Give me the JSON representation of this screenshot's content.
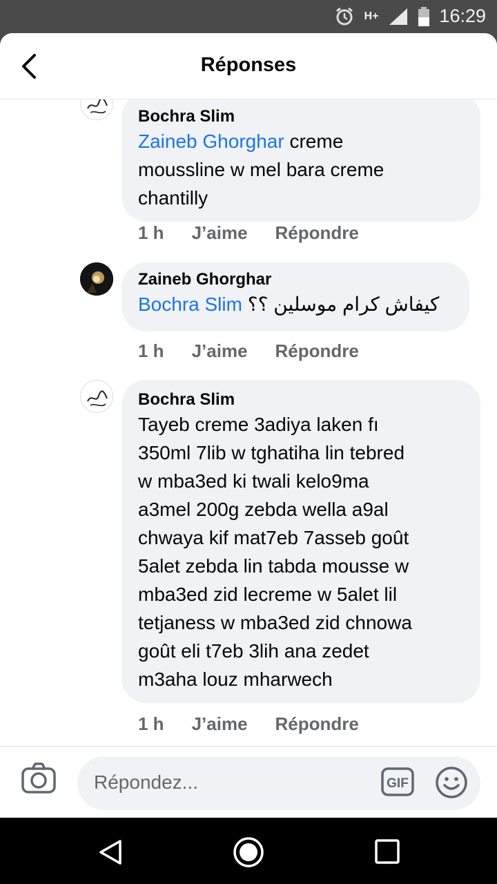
{
  "status": {
    "time": "16:29",
    "network": "H+"
  },
  "header": {
    "title": "Réponses"
  },
  "comments": [
    {
      "author": "Bochra Slim",
      "mention": "Zaineb Ghorghar",
      "lines": [
        " creme",
        "moussline w mel bara creme",
        "chantilly"
      ],
      "time": "1 h",
      "like": "J’aime",
      "reply": "Répondre"
    },
    {
      "author": "Zaineb Ghorghar",
      "mention": "Bochra Slim",
      "rest": " كيفاش كرام موسلين ؟؟",
      "time": "1 h",
      "like": "J’aime",
      "reply": "Répondre"
    },
    {
      "author": "Bochra Slim",
      "lines": [
        "Tayeb creme 3adiya laken fı",
        "350ml 7lib w tghatiha lin tebred",
        "w mba3ed ki twali kelo9ma",
        "a3mel 200g zebda wella a9al",
        "chwaya kif mat7eb 7asseb goût",
        "5alet zebda lin tabda mousse w",
        "mba3ed zid lecreme w 5alet lil",
        "tetjaness w mba3ed zid chnowa",
        "goût eli t7eb 3lih ana zedet",
        "m3aha louz mharwech"
      ],
      "time": "1 h",
      "like": "J’aime",
      "reply": "Répondre"
    }
  ],
  "composer": {
    "placeholder": "Répondez...",
    "gif_label": "GIF"
  },
  "colors": {
    "mention": "#1b74e4",
    "bubble": "#f0f2f5",
    "secondary_text": "#65676b"
  },
  "icons": [
    "back-arrow-icon",
    "alarm-icon",
    "signal-icon",
    "battery-icon",
    "camera-icon",
    "gif-icon",
    "smiley-icon",
    "nav-back-icon",
    "nav-home-icon",
    "nav-recents-icon"
  ]
}
